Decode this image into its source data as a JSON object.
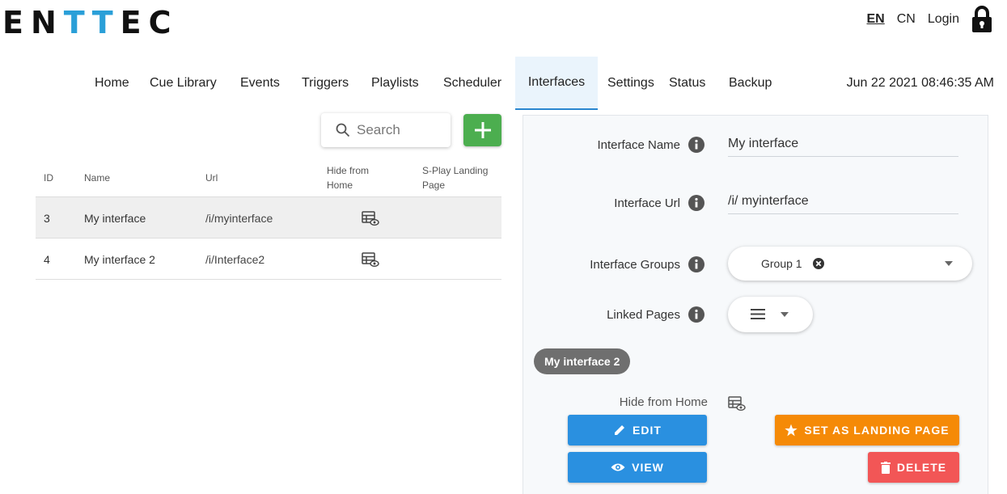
{
  "brand": {
    "logo_letters": [
      "E",
      "N",
      "T",
      "T",
      "E",
      "C"
    ]
  },
  "header": {
    "lang_en": "EN",
    "lang_cn": "CN",
    "login": "Login"
  },
  "nav": {
    "items": [
      "Home",
      "Cue Library",
      "Events",
      "Triggers",
      "Playlists",
      "Scheduler",
      "Interfaces",
      "Settings",
      "Status",
      "Backup"
    ],
    "active": "Interfaces",
    "datetime": "Jun 22 2021 08:46:35 AM"
  },
  "search": {
    "placeholder": "Search"
  },
  "table": {
    "headers": {
      "id": "ID",
      "name": "Name",
      "url": "Url",
      "hide": "Hide from Home",
      "landing": "S-Play Landing Page"
    },
    "rows": [
      {
        "id": "3",
        "name": "My interface",
        "url_prefix": "/i/",
        "url_slug": "myinterface"
      },
      {
        "id": "4",
        "name": "My interface 2",
        "url_prefix": "/i/",
        "url_slug": "Interface2"
      }
    ]
  },
  "detail": {
    "name_label": "Interface Name",
    "name_value": "My interface",
    "url_label": "Interface Url",
    "url_prefix": "/i/",
    "url_value": "myinterface",
    "groups_label": "Interface Groups",
    "group_chip": "Group 1",
    "linked_label": "Linked Pages",
    "linked_chip": "My interface 2",
    "hide_label": "Hide from Home",
    "btn_edit": "EDIT",
    "btn_view": "VIEW",
    "btn_landing": "SET AS LANDING PAGE",
    "btn_delete": "DELETE"
  },
  "colors": {
    "accent": "#2a9fd8",
    "green": "#4cae4f",
    "blue_button": "#2a90e0",
    "orange_button": "#f58a07",
    "red_button": "#f25656"
  }
}
